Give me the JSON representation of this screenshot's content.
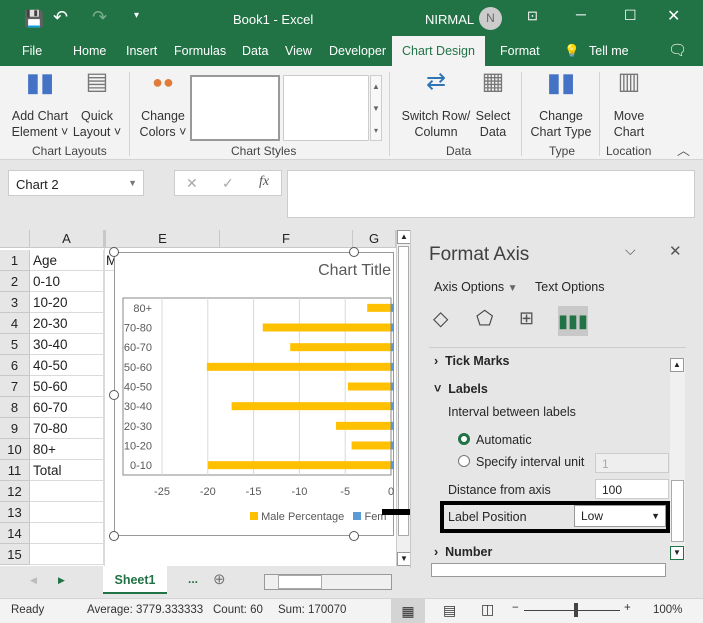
{
  "window": {
    "title": "Book1  -  Excel",
    "user": "NIRMAL",
    "avatar_initial": "N"
  },
  "tabs": [
    {
      "label": "File"
    },
    {
      "label": "Home"
    },
    {
      "label": "Insert"
    },
    {
      "label": "Formulas"
    },
    {
      "label": "Data"
    },
    {
      "label": "View"
    },
    {
      "label": "Developer"
    },
    {
      "label": "Chart Design",
      "active": true
    },
    {
      "label": "Format"
    },
    {
      "label": "Tell me"
    }
  ],
  "ribbon": {
    "add_chart_element": [
      "Add Chart",
      "Element ˅"
    ],
    "quick_layout": [
      "Quick",
      "Layout ˅"
    ],
    "change_colors": [
      "Change",
      "Colors ˅"
    ],
    "switch_row_column": [
      "Switch Row/",
      "Column"
    ],
    "select_data": [
      "Select",
      "Data"
    ],
    "change_chart_type": [
      "Change",
      "Chart Type"
    ],
    "move_chart": [
      "Move",
      "Chart"
    ],
    "groups": {
      "chart_layouts": "Chart Layouts",
      "chart_styles": "Chart Styles",
      "data": "Data",
      "type": "Type",
      "location": "Location"
    }
  },
  "formula_bar": {
    "name_box": "Chart 2",
    "fx": "fx",
    "value": ""
  },
  "columns": [
    "A",
    "E",
    "F",
    "G"
  ],
  "rows": [
    {
      "n": "1",
      "a": "Age",
      "b": "M"
    },
    {
      "n": "2",
      "a": "0-10"
    },
    {
      "n": "3",
      "a": "10-20"
    },
    {
      "n": "4",
      "a": "20-30"
    },
    {
      "n": "5",
      "a": "30-40"
    },
    {
      "n": "6",
      "a": "40-50"
    },
    {
      "n": "7",
      "a": "50-60"
    },
    {
      "n": "8",
      "a": "60-70"
    },
    {
      "n": "9",
      "a": "70-80"
    },
    {
      "n": "10",
      "a": "80+"
    },
    {
      "n": "11",
      "a": "Total"
    },
    {
      "n": "12",
      "a": ""
    },
    {
      "n": "13",
      "a": ""
    },
    {
      "n": "14",
      "a": ""
    },
    {
      "n": "15",
      "a": ""
    }
  ],
  "chart_data": {
    "type": "bar",
    "orientation": "horizontal",
    "title": "Chart Title",
    "categories": [
      "0-10",
      "10-20",
      "20-30",
      "30-40",
      "40-50",
      "50-60",
      "60-70",
      "70-80",
      "80+"
    ],
    "series": [
      {
        "name": "Male Percentage",
        "color": "#FFC000",
        "values": [
          -20,
          -4.3,
          -6,
          -17.4,
          -4.7,
          -20.1,
          -11,
          -14,
          -2.6
        ]
      },
      {
        "name": "Female Percentage",
        "color": "#5B9BD5"
      }
    ],
    "legend_visible": "Male Percentage",
    "legend_visible_female": "Fem",
    "xlim": [
      -25,
      0
    ],
    "xticks": [
      "-25",
      "-20",
      "-15",
      "-10",
      "-5",
      "0"
    ],
    "grid": true,
    "legend": "bottom"
  },
  "panel": {
    "title": "Format Axis",
    "axis_options": "Axis Options",
    "text_options": "Text Options",
    "tick_marks": "Tick Marks",
    "labels": "Labels",
    "interval_between": "Interval between labels",
    "automatic": "Automatic",
    "specify": "Specify interval unit",
    "specify_value": "1",
    "distance": "Distance from axis",
    "distance_value": "100",
    "label_position": "Label Position",
    "label_position_value": "Low",
    "number": "Number"
  },
  "sheet": {
    "tab": "Sheet1",
    "more": "..."
  },
  "status": {
    "ready": "Ready",
    "average": "Average: 3779.333333",
    "count": "Count: 60",
    "sum": "Sum: 170070",
    "zoom": "100%"
  },
  "colors": {
    "accent": "#217346",
    "male": "#FFC000",
    "female": "#5B9BD5"
  }
}
